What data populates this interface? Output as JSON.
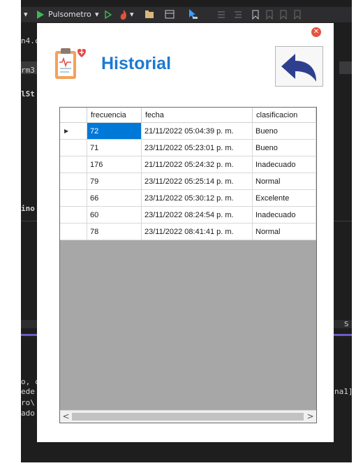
{
  "ide": {
    "toolbar": {
      "run_target": "Pulsometro",
      "dropdown_glyph": "▾"
    },
    "side_text": [
      "n4.c",
      "rm3",
      "lSt",
      "ino",
      "o, c",
      "ede",
      "ro\\",
      "ado"
    ],
    "right_text": [
      "S",
      "na1]"
    ]
  },
  "dialog": {
    "title": "Historial",
    "close_glyph": "✕",
    "icons": {
      "logo": "clipboard-heart-icon",
      "back": "undo-arrow-icon",
      "close": "close-icon"
    },
    "colors": {
      "title": "#1b7ad2",
      "selection": "#0078d7",
      "back_arrow": "#2e3f8f",
      "grid_empty": "#a7a7a7"
    },
    "grid": {
      "columns": [
        "frecuencia",
        "fecha",
        "clasificacion"
      ],
      "rows": [
        {
          "frecuencia": "72",
          "fecha": "21/11/2022 05:04:39 p. m.",
          "clasificacion": "Bueno"
        },
        {
          "frecuencia": "71",
          "fecha": "23/11/2022 05:23:01 p. m.",
          "clasificacion": "Bueno"
        },
        {
          "frecuencia": "176",
          "fecha": "21/11/2022 05:24:32 p. m.",
          "clasificacion": "Inadecuado"
        },
        {
          "frecuencia": "79",
          "fecha": "23/11/2022 05:25:14 p. m.",
          "clasificacion": "Normal"
        },
        {
          "frecuencia": "66",
          "fecha": "23/11/2022 05:30:12 p. m.",
          "clasificacion": "Excelente"
        },
        {
          "frecuencia": "60",
          "fecha": "23/11/2022 08:24:54 p. m.",
          "clasificacion": "Inadecuado"
        },
        {
          "frecuencia": "78",
          "fecha": "23/11/2022 08:41:41 p. m.",
          "clasificacion": "Normal"
        }
      ],
      "current_row_glyph": "▶",
      "scroll_left_glyph": "<",
      "scroll_right_glyph": ">"
    }
  }
}
